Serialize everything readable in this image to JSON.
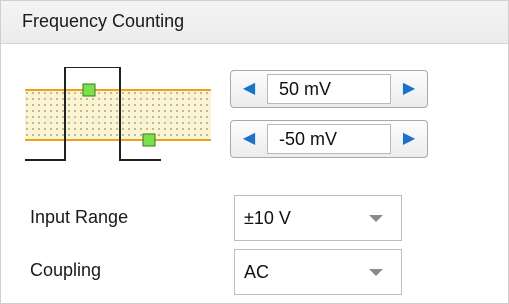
{
  "header": {
    "title": "Frequency Counting"
  },
  "icons": {
    "decrement": "left-triangle",
    "increment": "right-triangle",
    "dropdown": "chevron-down",
    "hysteresis": "threshold-diagram"
  },
  "thresholds": {
    "upper": {
      "value": "50 mV"
    },
    "lower": {
      "value": "-50 mV"
    }
  },
  "input_range": {
    "label": "Input Range",
    "value": "±10 V"
  },
  "coupling": {
    "label": "Coupling",
    "value": "AC"
  },
  "colors": {
    "band_fill": "#fbf4d2",
    "band_edge": "#f0a11c",
    "marker": "#7ce04a",
    "spin_arrow": "#1a73c9"
  }
}
